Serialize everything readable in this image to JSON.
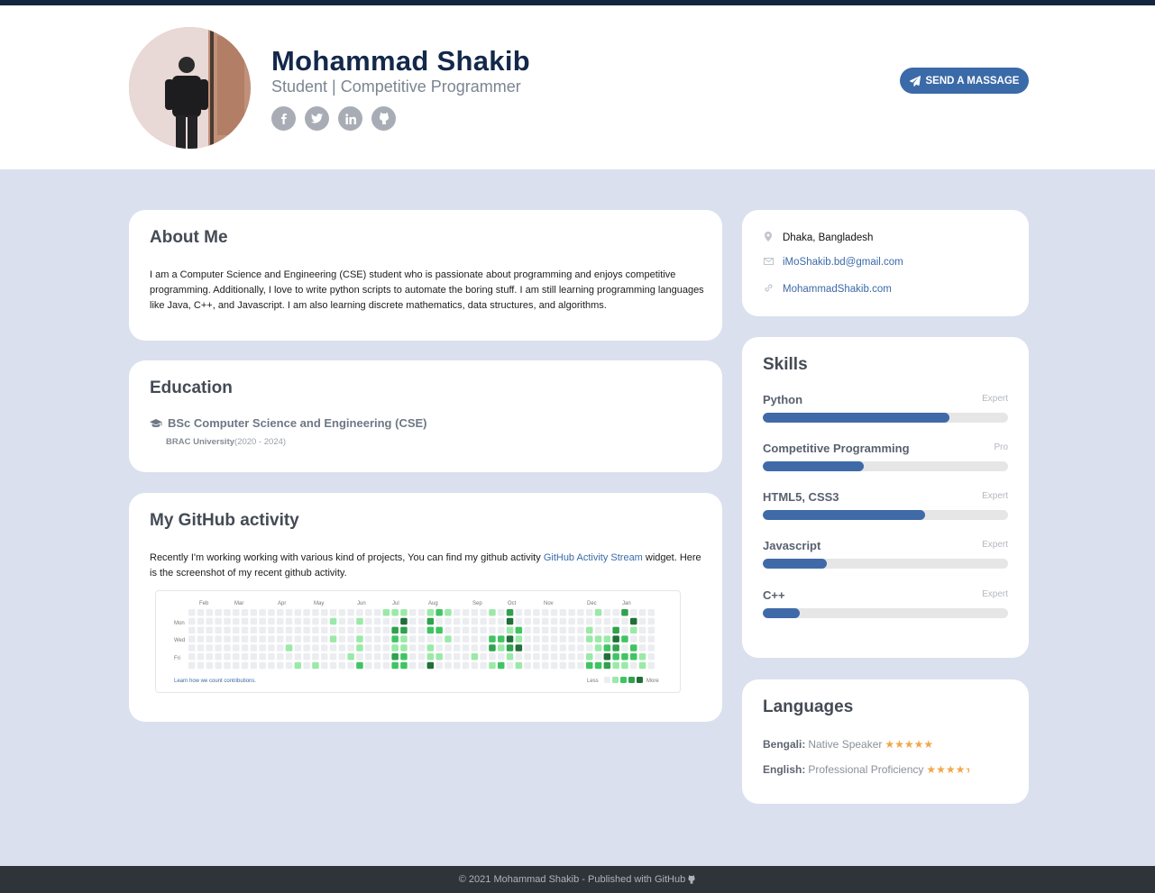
{
  "header": {
    "name": "Mohammad Shakib",
    "tagline": "Student | Competitive Programmer",
    "send_button": "SEND A MASSAGE",
    "socials": [
      {
        "icon": "facebook-icon",
        "glyph": "f"
      },
      {
        "icon": "twitter-icon",
        "glyph": "t"
      },
      {
        "icon": "linkedin-icon",
        "glyph": "in"
      },
      {
        "icon": "github-icon",
        "glyph": "gh"
      }
    ]
  },
  "about": {
    "title": "About Me",
    "text": "I am a Computer Science and Engineering (CSE) student who is passionate about programming and enjoys competitive programming. Additionally, I love to write python scripts to automate the boring stuff. I am still learning programming languages like Java, C++, and Javascript. I am also learning discrete mathematics, data structures, and algorithms."
  },
  "education": {
    "title": "Education",
    "degree": "BSc Computer Science and Engineering (CSE)",
    "university": "BRAC University",
    "years": "(2020 - 2024)"
  },
  "github": {
    "title": "My GitHub activity",
    "text_before": "Recently I'm working working with various kind of projects, You can find my github activity ",
    "link_text": "GitHub Activity Stream",
    "text_after": " widget. Here is the screenshot of my recent github activity.",
    "graph": {
      "months": [
        "Feb",
        "Mar",
        "Apr",
        "May",
        "Jun",
        "Jul",
        "Aug",
        "Sep",
        "Oct",
        "Nov",
        "Dec",
        "Jan"
      ],
      "days": [
        "Mon",
        "Wed",
        "Fri"
      ],
      "footer_link": "Learn how we count contributions.",
      "less": "Less",
      "more": "More",
      "colors": [
        "#ebedf0",
        "#9be9a8",
        "#40c463",
        "#30a14e",
        "#216e39"
      ]
    }
  },
  "contact": {
    "location": "Dhaka, Bangladesh",
    "email": "iMoShakib.bd@gmail.com",
    "website": "MohammadShakib.com"
  },
  "skills": {
    "title": "Skills",
    "items": [
      {
        "name": "Python",
        "level": "Expert",
        "percent": 76
      },
      {
        "name": "Competitive Programming",
        "level": "Pro",
        "percent": 41
      },
      {
        "name": "HTML5, CSS3",
        "level": "Expert",
        "percent": 66
      },
      {
        "name": "Javascript",
        "level": "Expert",
        "percent": 26
      },
      {
        "name": "C++",
        "level": "Expert",
        "percent": 15
      }
    ]
  },
  "languages": {
    "title": "Languages",
    "items": [
      {
        "name": "Bengali:",
        "level": "Native Speaker",
        "stars": "★★★★★"
      },
      {
        "name": "English:",
        "level": "Professional Proficiency",
        "stars": "★★★★"
      }
    ]
  },
  "footer": {
    "text": "© 2021 Mohammad Shakib - Published with GitHub"
  },
  "colors": {
    "accent": "#3b6aa8",
    "header_dark": "#13284a",
    "page_bg": "#dae0ee"
  }
}
